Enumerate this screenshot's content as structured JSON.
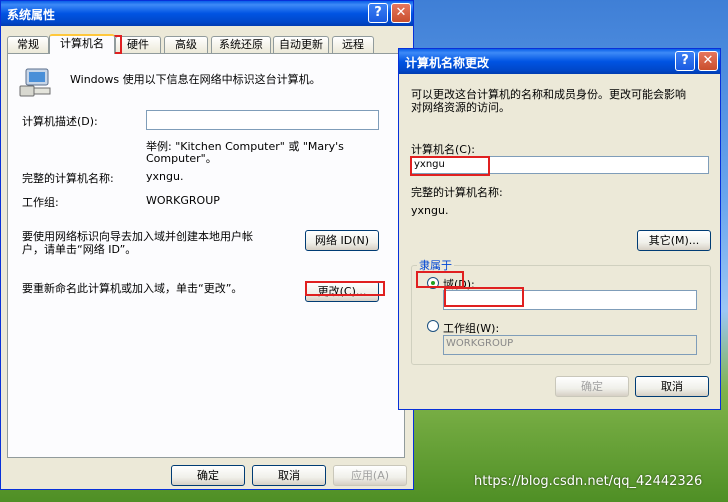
{
  "system_properties": {
    "title": "系统属性",
    "help_btn": "?",
    "close_btn": "✕",
    "tabs": [
      "常规",
      "计算机名",
      "硬件",
      "高级",
      "系统还原",
      "自动更新",
      "远程"
    ],
    "intro": "Windows 使用以下信息在网络中标识这台计算机。",
    "description_label": "计算机描述(D):",
    "description_value": "",
    "example_line1": "举例: \"Kitchen Computer\" 或 \"Mary's",
    "example_line2": "Computer\"。",
    "full_name_label": "完整的计算机名称:",
    "full_name_value": "yxngu.",
    "workgroup_label": "工作组:",
    "workgroup_value": "WORKGROUP",
    "network_id_text_line1": "要使用网络标识向导去加入域并创建本地用户帐",
    "network_id_text_line2": "户，请单击“网络 ID”。",
    "network_id_button": "网络 ID(N)",
    "rename_text": "要重新命名此计算机或加入域，单击“更改”。",
    "change_button": "更改(C)...",
    "ok": "确定",
    "cancel": "取消",
    "apply": "应用(A)"
  },
  "computer_name_changes": {
    "title": "计算机名称更改",
    "help_btn": "?",
    "close_btn": "✕",
    "intro_line1": "可以更改这台计算机的名称和成员身份。更改可能会影响",
    "intro_line2": "对网络资源的访问。",
    "name_label": "计算机名(C):",
    "name_value": "yxngu",
    "full_name_label": "完整的计算机名称:",
    "full_name_value": "yxngu.",
    "other_button": "其它(M)...",
    "member_of_label": "隶属于",
    "domain_label": "域(D):",
    "domain_value": "",
    "workgroup_label": "工作组(W):",
    "workgroup_value": "WORKGROUP",
    "ok": "确定",
    "cancel": "取消"
  },
  "watermark": "https://blog.csdn.net/qq_42442326"
}
